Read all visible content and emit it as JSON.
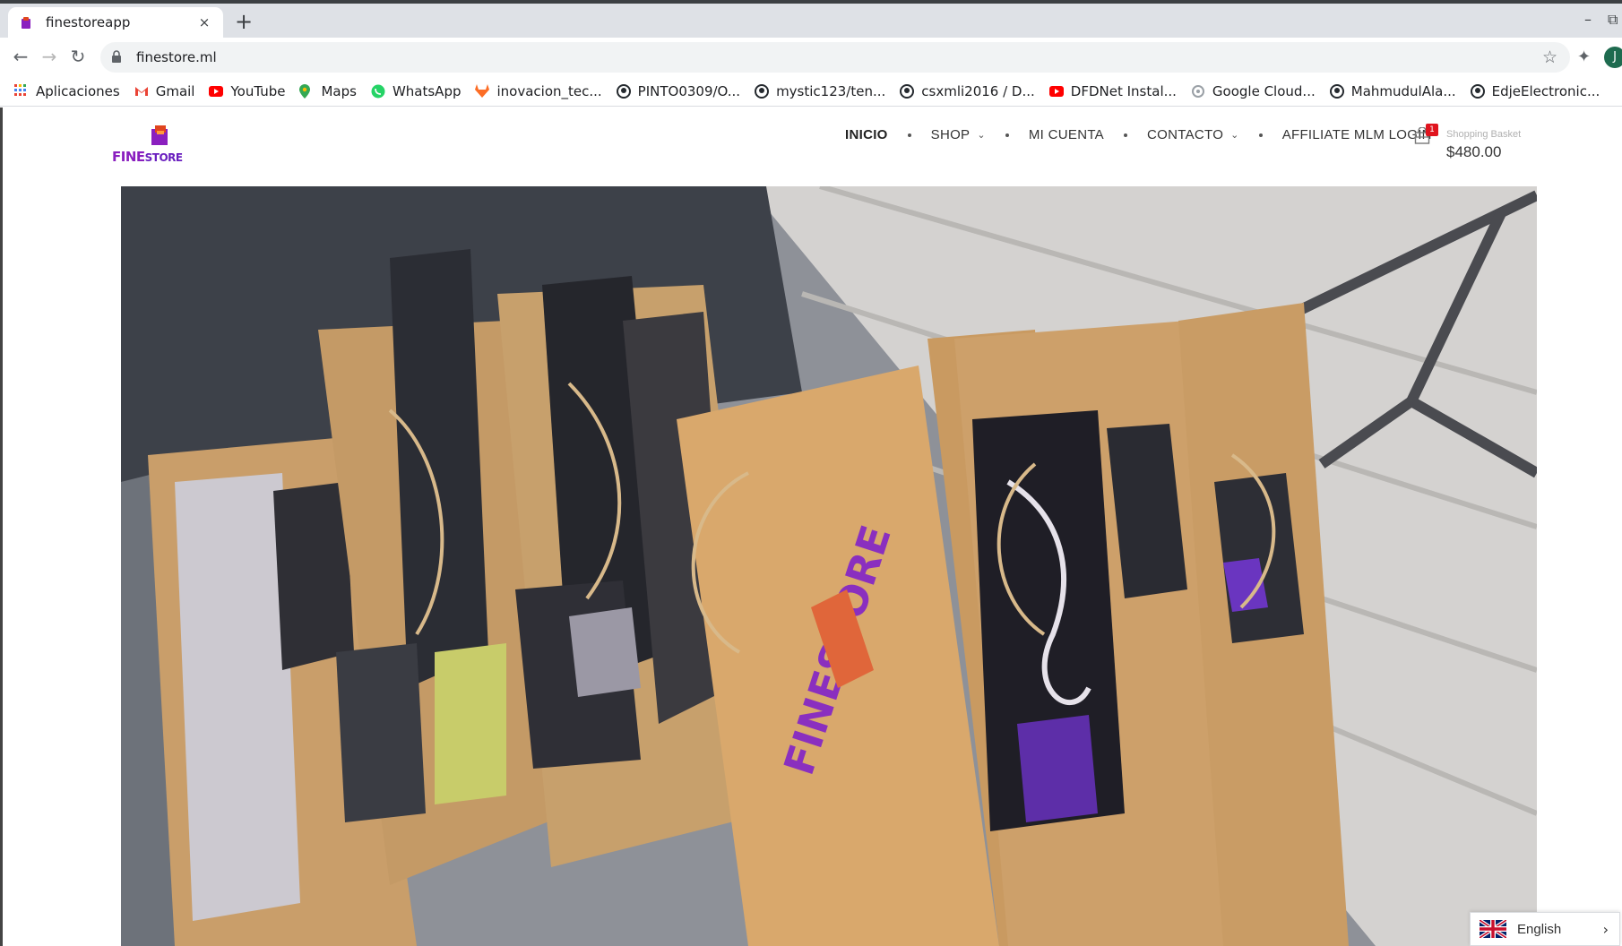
{
  "browser": {
    "tab_title": "finestoreapp",
    "tab_close": "×",
    "new_tab": "+",
    "url": "finestore.ml",
    "profile_initial": "J",
    "minimize": "–",
    "restore": "⧉"
  },
  "bookmarks": [
    {
      "label": "Aplicaciones",
      "icon": "apps-grid-icon"
    },
    {
      "label": "Gmail",
      "icon": "gmail-icon"
    },
    {
      "label": "YouTube",
      "icon": "youtube-icon"
    },
    {
      "label": "Maps",
      "icon": "maps-icon"
    },
    {
      "label": "WhatsApp",
      "icon": "whatsapp-icon"
    },
    {
      "label": "inovacion_tec...",
      "icon": "gitlab-icon"
    },
    {
      "label": "PINTO0309/O...",
      "icon": "github-icon"
    },
    {
      "label": "mystic123/ten...",
      "icon": "github-icon"
    },
    {
      "label": "csxmli2016 / D...",
      "icon": "github-icon"
    },
    {
      "label": "DFDNet Instal...",
      "icon": "youtube-icon"
    },
    {
      "label": "Google Cloud...",
      "icon": "google-cloud-icon"
    },
    {
      "label": "MahmudulAla...",
      "icon": "github-icon"
    },
    {
      "label": "EdjeElectronic...",
      "icon": "github-icon"
    }
  ],
  "site": {
    "logo_fine": "FINE",
    "logo_store": "STORE",
    "nav": {
      "inicio": "INICIO",
      "shop": "SHOP",
      "mi_cuenta": "MI CUENTA",
      "contacto": "CONTACTO",
      "affiliate": "AFFILIATE MLM LOGIN"
    },
    "cart": {
      "badge": "1",
      "label": "Shopping Basket",
      "total": "$480.00"
    },
    "language": {
      "label": "English"
    }
  },
  "colors": {
    "brand_purple": "#8a1fbf",
    "badge_red": "#e0141e"
  }
}
